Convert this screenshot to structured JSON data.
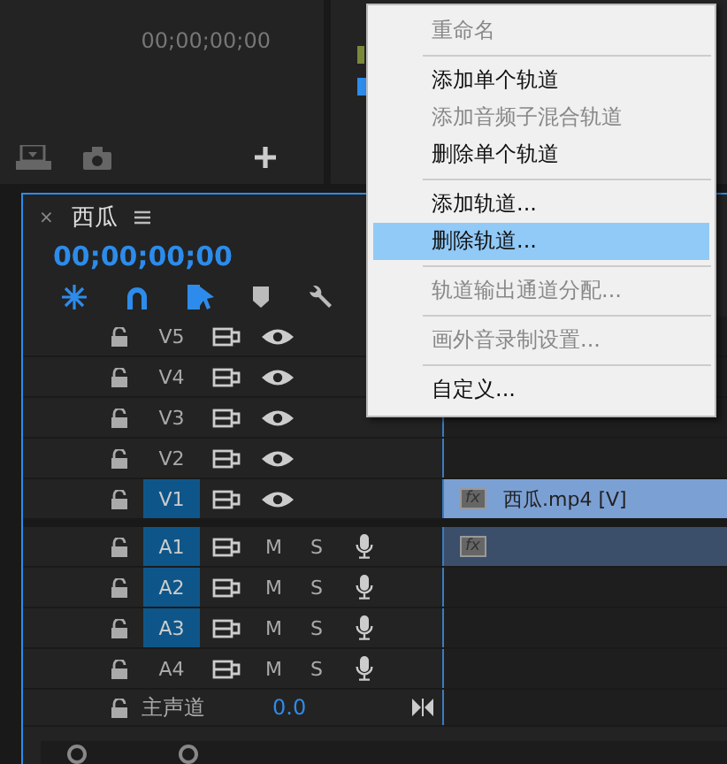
{
  "program_monitor": {
    "timecode": "00;00;00;00"
  },
  "timeline": {
    "title": "西瓜",
    "close": "×",
    "timecode": "00;00;00;00",
    "tools": [
      {
        "kind": "snap",
        "on": true
      },
      {
        "kind": "magnet",
        "on": true
      },
      {
        "kind": "linked",
        "on": true
      },
      {
        "kind": "marker",
        "on": false
      },
      {
        "kind": "wrench",
        "on": false
      }
    ],
    "tracks": [
      {
        "kind": "video",
        "name": "V5",
        "targeted": false
      },
      {
        "kind": "video",
        "name": "V4",
        "targeted": false
      },
      {
        "kind": "video",
        "name": "V3",
        "targeted": false
      },
      {
        "kind": "video",
        "name": "V2",
        "targeted": false
      },
      {
        "kind": "video",
        "name": "V1",
        "targeted": true,
        "clip": {
          "badge": "fx",
          "label": "西瓜.mp4 [V]"
        }
      },
      {
        "kind": "audio",
        "name": "A1",
        "targeted": true,
        "mute": "M",
        "solo": "S",
        "clip": {
          "badge": "fx"
        }
      },
      {
        "kind": "audio",
        "name": "A2",
        "targeted": true,
        "mute": "M",
        "solo": "S"
      },
      {
        "kind": "audio",
        "name": "A3",
        "targeted": true,
        "mute": "M",
        "solo": "S"
      },
      {
        "kind": "audio",
        "name": "A4",
        "targeted": false,
        "mute": "M",
        "solo": "S"
      }
    ],
    "master": {
      "label": "主声道",
      "value": "0.0"
    }
  },
  "context_menu": [
    {
      "kind": "item",
      "label": "重命名",
      "disabled": true,
      "selected": false
    },
    {
      "kind": "separator"
    },
    {
      "kind": "item",
      "label": "添加单个轨道",
      "disabled": false,
      "selected": false
    },
    {
      "kind": "item",
      "label": "添加音频子混合轨道",
      "disabled": true,
      "selected": false
    },
    {
      "kind": "item",
      "label": "删除单个轨道",
      "disabled": false,
      "selected": false
    },
    {
      "kind": "separator"
    },
    {
      "kind": "item",
      "label": "添加轨道...",
      "disabled": false,
      "selected": false
    },
    {
      "kind": "item",
      "label": "删除轨道...",
      "disabled": false,
      "selected": true
    },
    {
      "kind": "separator"
    },
    {
      "kind": "item",
      "label": "轨道输出通道分配...",
      "disabled": true,
      "selected": false
    },
    {
      "kind": "separator"
    },
    {
      "kind": "item",
      "label": "画外音录制设置...",
      "disabled": true,
      "selected": false
    },
    {
      "kind": "separator"
    },
    {
      "kind": "item",
      "label": "自定义...",
      "disabled": false,
      "selected": false
    }
  ]
}
